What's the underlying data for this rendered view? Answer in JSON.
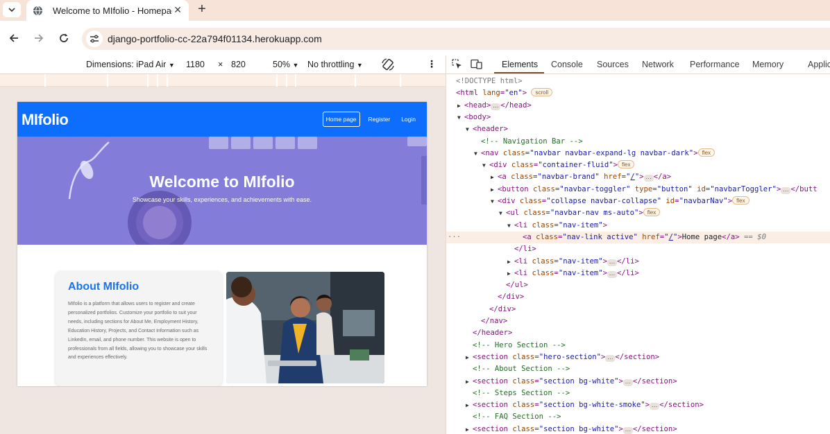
{
  "browser": {
    "tab_title": "Welcome to MIfolio - Homepage",
    "url": "django-portfolio-cc-22a794f01134.herokuapp.com"
  },
  "device_toolbar": {
    "dimensions_label": "Dimensions: iPad Air",
    "width": "1180",
    "times": "×",
    "height": "820",
    "zoom": "50%",
    "throttling": "No throttling"
  },
  "site": {
    "brand": "MIfolio",
    "nav": [
      {
        "label": "Home page"
      },
      {
        "label": "Register"
      },
      {
        "label": "Login"
      }
    ],
    "hero": {
      "title": "Welcome to MIfolio",
      "subtitle": "Showcase your skills, experiences, and achievements with ease."
    },
    "about": {
      "title": "About MIfolio",
      "text": "MIfolio is a platform that allows users to register and create personalized portfolios. Customize your portfolio to suit your needs, including sections for About Me, Employment History, Education History, Projects, and Contact Information such as LinkedIn, email, and phone number. This website is open to professionals from all fields, allowing you to showcase your skills and experiences effectively."
    },
    "colors": {
      "navbar": "#0d6efd",
      "hero_overlay": "#7f7ad6",
      "about_title": "#1a73e8"
    }
  },
  "devtools": {
    "tabs": [
      "Elements",
      "Console",
      "Sources",
      "Network",
      "Performance",
      "Memory",
      "Applicat"
    ],
    "active_tab": "Elements"
  }
}
